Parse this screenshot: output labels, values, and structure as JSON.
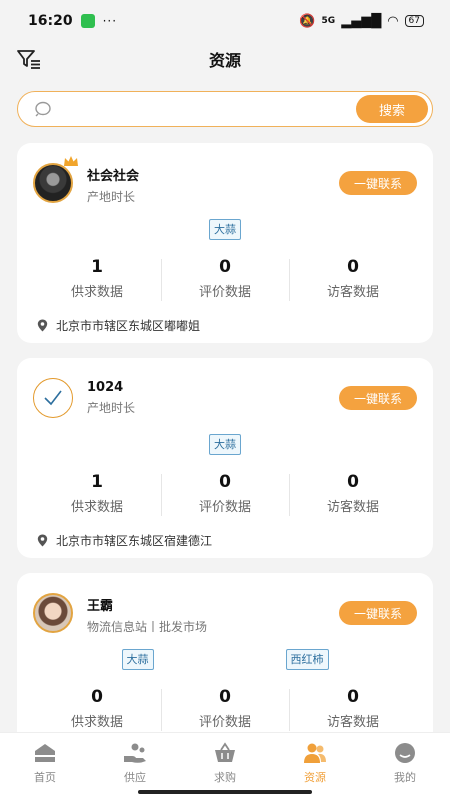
{
  "status_bar": {
    "time": "16:20",
    "dots": "···",
    "network": "5G",
    "battery": "67"
  },
  "header": {
    "title": "资源"
  },
  "search": {
    "placeholder": "",
    "button_label": "搜索"
  },
  "cards": [
    {
      "name": "社会社会",
      "subtitle": "产地时长",
      "contact_label": "一键联系",
      "tags": [
        "大蒜"
      ],
      "stats": [
        {
          "value": "1",
          "label": "供求数据"
        },
        {
          "value": "0",
          "label": "评价数据"
        },
        {
          "value": "0",
          "label": "访客数据"
        }
      ],
      "address": "北京市市辖区东城区嘟嘟姐"
    },
    {
      "name": "1024",
      "subtitle": "产地时长",
      "contact_label": "一键联系",
      "tags": [
        "大蒜"
      ],
      "stats": [
        {
          "value": "1",
          "label": "供求数据"
        },
        {
          "value": "0",
          "label": "评价数据"
        },
        {
          "value": "0",
          "label": "访客数据"
        }
      ],
      "address": "北京市市辖区东城区宿建德江"
    },
    {
      "name": "王霸",
      "subtitle": "物流信息站丨批发市场",
      "contact_label": "一键联系",
      "tags": [
        "大蒜",
        "西红柿"
      ],
      "stats": [
        {
          "value": "0",
          "label": "供求数据"
        },
        {
          "value": "0",
          "label": "评价数据"
        },
        {
          "value": "0",
          "label": "访客数据"
        }
      ]
    }
  ],
  "tabbar": {
    "items": [
      {
        "label": "首页",
        "icon": "home-icon"
      },
      {
        "label": "供应",
        "icon": "supply-icon"
      },
      {
        "label": "求购",
        "icon": "basket-icon"
      },
      {
        "label": "资源",
        "icon": "resources-icon"
      },
      {
        "label": "我的",
        "icon": "profile-icon"
      }
    ],
    "active": "资源"
  },
  "colors": {
    "accent": "#f4a23f",
    "tag_border": "#6aa6cf",
    "tag_text": "#2d6f9e",
    "background": "#f3f3f3"
  }
}
